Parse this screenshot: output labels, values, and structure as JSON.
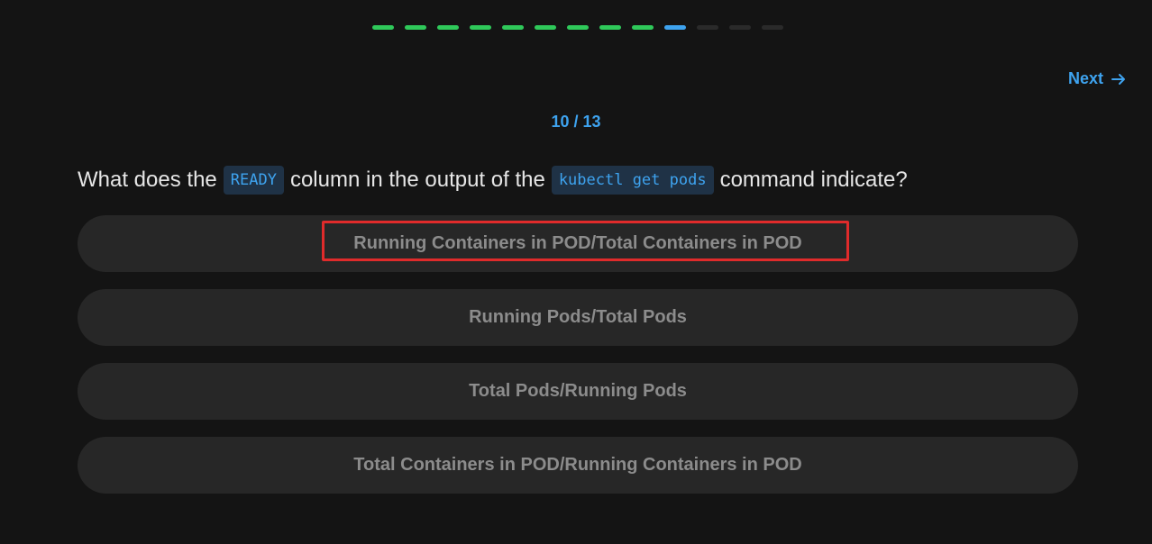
{
  "progress": {
    "segments": [
      "done",
      "done",
      "done",
      "done",
      "done",
      "done",
      "done",
      "done",
      "done",
      "current",
      "pending",
      "pending",
      "pending"
    ]
  },
  "nav": {
    "next_label": "Next"
  },
  "counter": "10 / 13",
  "question": {
    "part1": "What does the",
    "code1": "READY",
    "part2": "column in the output of the",
    "code2": "kubectl get pods",
    "part3": "command indicate?"
  },
  "options": [
    {
      "label": "Running Containers in POD/Total Containers in POD",
      "highlighted": true
    },
    {
      "label": "Running Pods/Total Pods",
      "highlighted": false
    },
    {
      "label": "Total Pods/Running Pods",
      "highlighted": false
    },
    {
      "label": "Total Containers in POD/Running Containers in POD",
      "highlighted": false
    }
  ],
  "colors": {
    "background": "#141414",
    "done": "#2fc95a",
    "current": "#3ea3ef",
    "pending": "#2a2a2a",
    "accent": "#3ea3ef",
    "highlight": "#e02b2b"
  }
}
